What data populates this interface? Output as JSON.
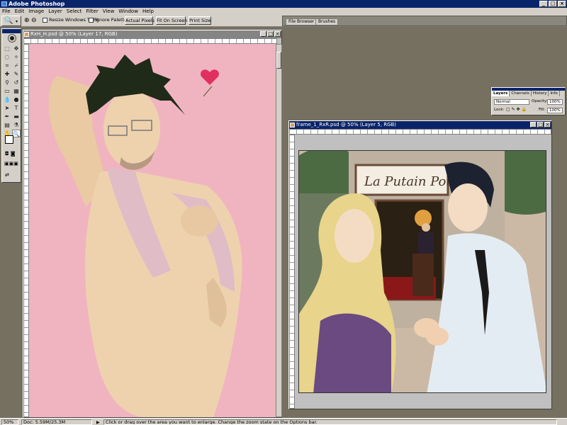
{
  "app": {
    "title": "Adobe Photoshop"
  },
  "menu": [
    "File",
    "Edit",
    "Image",
    "Layer",
    "Select",
    "Filter",
    "View",
    "Window",
    "Help"
  ],
  "options_bar": {
    "resize_windows_label": "Resize Windows To Fit",
    "ignore_palettes_label": "Ignore Palettes",
    "actual_pixels": "Actual Pixels",
    "fit_on_screen": "Fit On Screen",
    "print_size": "Print Size",
    "well_tabs": [
      "File Browser",
      "Brushes"
    ]
  },
  "documents": [
    {
      "title": "RxH_H.psd @ 50% (Layer 17, RGB)",
      "active": false,
      "bg": "#f0b4c0"
    },
    {
      "title": "frame_1_RxR.psd @ 50% (Layer 5, RGB)",
      "active": true,
      "bg": "#ffffff"
    }
  ],
  "scene": {
    "sign_text": "La Putain Pot"
  },
  "layers_palette": {
    "tabs": [
      "Layers",
      "Channels",
      "History",
      "Info"
    ],
    "blend_mode": "Normal",
    "opacity_label": "Opacity:",
    "opacity_value": "100%",
    "lock_label": "Lock:",
    "fill_label": "Fill:",
    "fill_value": "100%"
  },
  "status_bar": {
    "zoom": "50%",
    "doc_size": "Doc: 5.59M/25.3M",
    "hint": "Click or drag over the area you want to enlarge. Change the zoom state on the Options bar."
  },
  "colors": {
    "titlebar": "#0a246a",
    "chrome": "#d4d0c8",
    "workspace": "#75705f",
    "canvas_pink": "#f0b4c0"
  }
}
